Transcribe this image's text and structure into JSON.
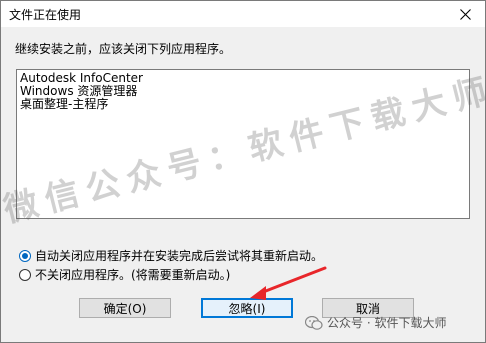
{
  "window": {
    "title": "文件正在使用",
    "close_glyph": "✕"
  },
  "message": "继续安装之前，应该关闭下列应用程序。",
  "app_list": [
    "Autodesk InfoCenter",
    "Windows 资源管理器",
    "桌面整理-主程序"
  ],
  "options": {
    "auto_close": "自动关闭应用程序并在安装完成后尝试将其重新启动。",
    "do_not_close": "不关闭应用程序。(将需要重新启动。)",
    "selected": "auto_close"
  },
  "buttons": {
    "ok": "确定(O)",
    "ignore": "忽略(I)",
    "cancel": "取消"
  },
  "watermark": {
    "text": "微信公众号：软件下载大师",
    "wechat_label": "公众号 · 软件下载大师"
  },
  "colors": {
    "accent": "#0078d7",
    "arrow": "#e8262a"
  }
}
